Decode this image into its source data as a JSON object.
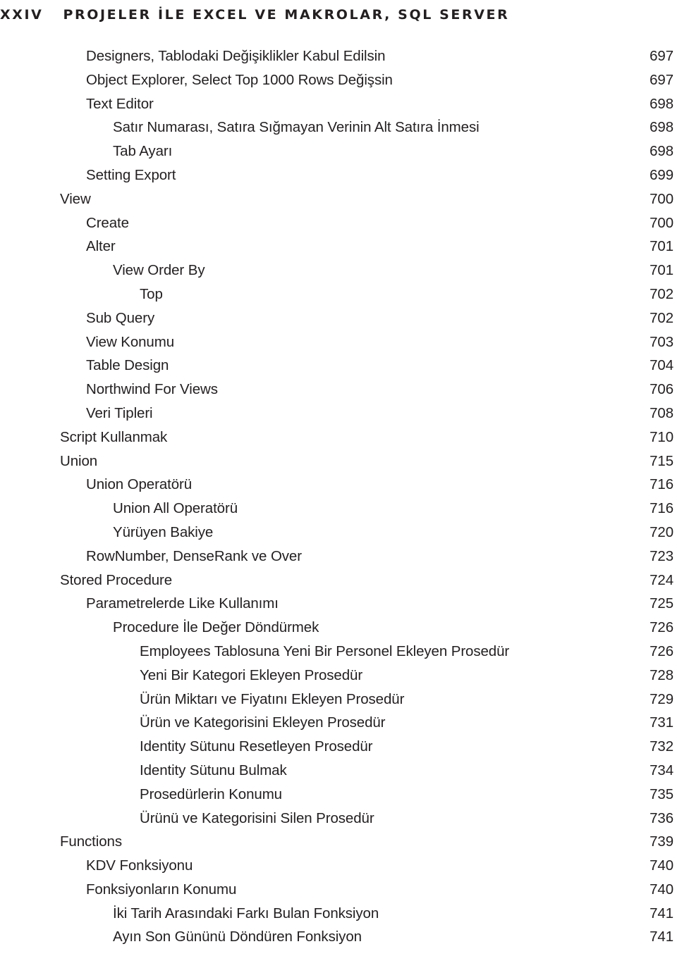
{
  "header": {
    "folio": "XXIV",
    "title": "PROJELER İLE EXCEL VE MAKROLAR, SQL SERVER"
  },
  "colors": {
    "text": "#231f20",
    "background": "#ffffff"
  },
  "toc": {
    "entries": [
      {
        "title": "Designers, Tablodaki Değişiklikler Kabul Edilsin",
        "page": "697",
        "level": 1
      },
      {
        "title": "Object Explorer, Select Top 1000 Rows Değişsin",
        "page": "697",
        "level": 1
      },
      {
        "title": "Text Editor",
        "page": "698",
        "level": 1
      },
      {
        "title": "Satır Numarası, Satıra Sığmayan Verinin Alt Satıra İnmesi",
        "page": "698",
        "level": 2
      },
      {
        "title": "Tab Ayarı",
        "page": "698",
        "level": 2
      },
      {
        "title": "Setting Export",
        "page": "699",
        "level": 1
      },
      {
        "title": "View",
        "page": "700",
        "level": 0
      },
      {
        "title": "Create",
        "page": "700",
        "level": 1
      },
      {
        "title": "Alter",
        "page": "701",
        "level": 1
      },
      {
        "title": "View Order By",
        "page": "701",
        "level": 2
      },
      {
        "title": "Top",
        "page": "702",
        "level": 3
      },
      {
        "title": "Sub Query",
        "page": "702",
        "level": 1
      },
      {
        "title": "View Konumu",
        "page": "703",
        "level": 1
      },
      {
        "title": "Table Design",
        "page": "704",
        "level": 1
      },
      {
        "title": "Northwind For Views",
        "page": "706",
        "level": 1
      },
      {
        "title": "Veri Tipleri",
        "page": "708",
        "level": 1
      },
      {
        "title": "Script Kullanmak",
        "page": "710",
        "level": 0
      },
      {
        "title": "Union",
        "page": "715",
        "level": 0
      },
      {
        "title": "Union Operatörü",
        "page": "716",
        "level": 1
      },
      {
        "title": "Union All Operatörü",
        "page": "716",
        "level": 2
      },
      {
        "title": "Yürüyen Bakiye",
        "page": "720",
        "level": 2
      },
      {
        "title": "RowNumber, DenseRank ve Over",
        "page": "723",
        "level": 1
      },
      {
        "title": "Stored Procedure",
        "page": "724",
        "level": 0
      },
      {
        "title": "Parametrelerde Like Kullanımı",
        "page": "725",
        "level": 1
      },
      {
        "title": "Procedure İle Değer Döndürmek",
        "page": "726",
        "level": 2
      },
      {
        "title": "Employees Tablosuna Yeni Bir Personel Ekleyen Prosedür",
        "page": "726",
        "level": 3
      },
      {
        "title": "Yeni Bir Kategori Ekleyen Prosedür",
        "page": "728",
        "level": 3
      },
      {
        "title": "Ürün Miktarı ve Fiyatını Ekleyen Prosedür",
        "page": "729",
        "level": 3
      },
      {
        "title": "Ürün ve Kategorisini Ekleyen Prosedür",
        "page": "731",
        "level": 3
      },
      {
        "title": "Identity Sütunu Resetleyen Prosedür",
        "page": "732",
        "level": 3
      },
      {
        "title": "Identity Sütunu Bulmak",
        "page": "734",
        "level": 3
      },
      {
        "title": "Prosedürlerin Konumu",
        "page": "735",
        "level": 3
      },
      {
        "title": "Ürünü ve Kategorisini Silen Prosedür",
        "page": "736",
        "level": 3
      },
      {
        "title": "Functions",
        "page": "739",
        "level": 0
      },
      {
        "title": "KDV Fonksiyonu",
        "page": "740",
        "level": 1
      },
      {
        "title": "Fonksiyonların Konumu",
        "page": "740",
        "level": 1
      },
      {
        "title": "İki Tarih Arasındaki Farkı Bulan Fonksiyon",
        "page": "741",
        "level": 2
      },
      {
        "title": "Ayın Son Gününü Döndüren Fonksiyon",
        "page": "741",
        "level": 2
      }
    ]
  }
}
